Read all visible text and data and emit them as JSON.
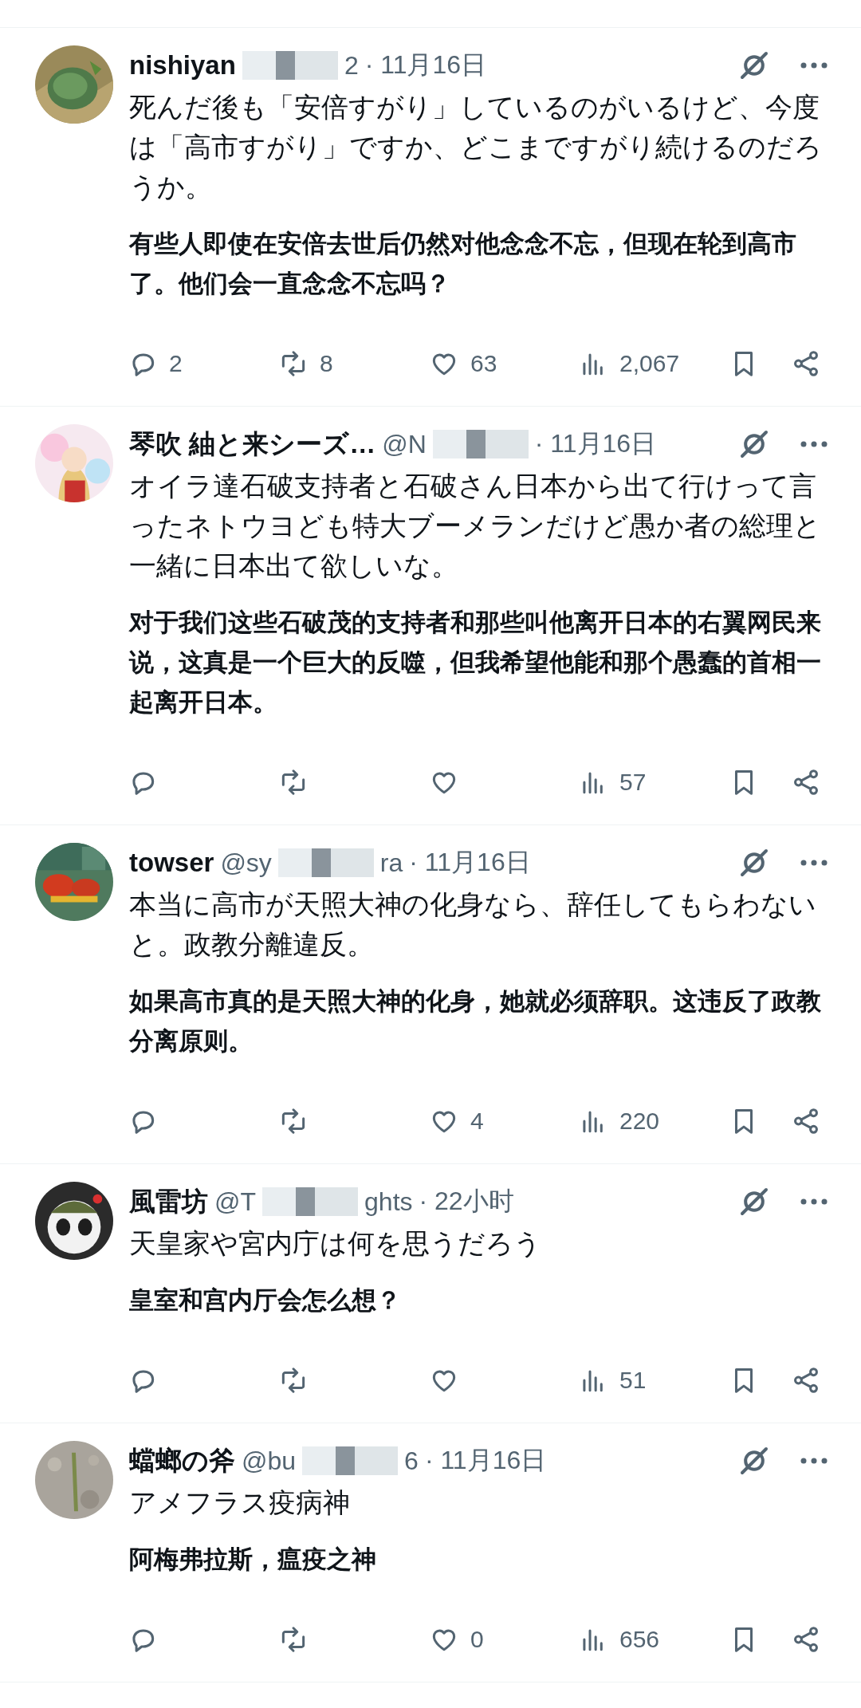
{
  "posts": [
    {
      "name": "nishiyan",
      "handle_end": "2",
      "time": "· 11月16日",
      "text": "死んだ後も「安倍すがり」しているのがいるけど、今度は「高市すがり」ですか、どこまですがり続けるのだろうか。",
      "translation": "有些人即使在安倍去世后仍然对他念念不忘，但现在轮到高市了。他们会一直念念不忘吗？",
      "replies": "2",
      "reposts": "8",
      "likes": "63",
      "views": "2,067"
    },
    {
      "name": "琴吹 紬と来シーズ…",
      "handle_start": "@N",
      "time": "· 11月16日",
      "text": "オイラ達石破支持者と石破さん日本から出て行けって言ったネトウヨども特大ブーメランだけど愚か者の総理と一緒に日本出て欲しいな。",
      "translation": "对于我们这些石破茂的支持者和那些叫他离开日本的右翼网民来说，这真是一个巨大的反噬，但我希望他能和那个愚蠢的首相一起离开日本。",
      "views": "57"
    },
    {
      "name": "towser",
      "handle_start": "@sy",
      "handle_end": "ra",
      "time": "· 11月16日",
      "text": "本当に高市が天照大神の化身なら、辞任してもらわないと。政教分離違反。",
      "translation": "如果高市真的是天照大神的化身，她就必须辞职。这违反了政教分离原则。",
      "likes": "4",
      "views": "220"
    },
    {
      "name": "風雷坊",
      "handle_start": "@T",
      "handle_end": "ghts",
      "time": "· 22小时",
      "text": "天皇家や宮内庁は何を思うだろう",
      "translation": "皇室和宫内厅会怎么想？",
      "views": "51"
    },
    {
      "name": "蟷螂の斧",
      "handle_start": "@bu",
      "handle_end": "6",
      "time": "· 11月16日",
      "text": "アメフラス疫病神",
      "translation": "阿梅弗拉斯，瘟疫之神",
      "likes": "0",
      "views": "656"
    }
  ]
}
